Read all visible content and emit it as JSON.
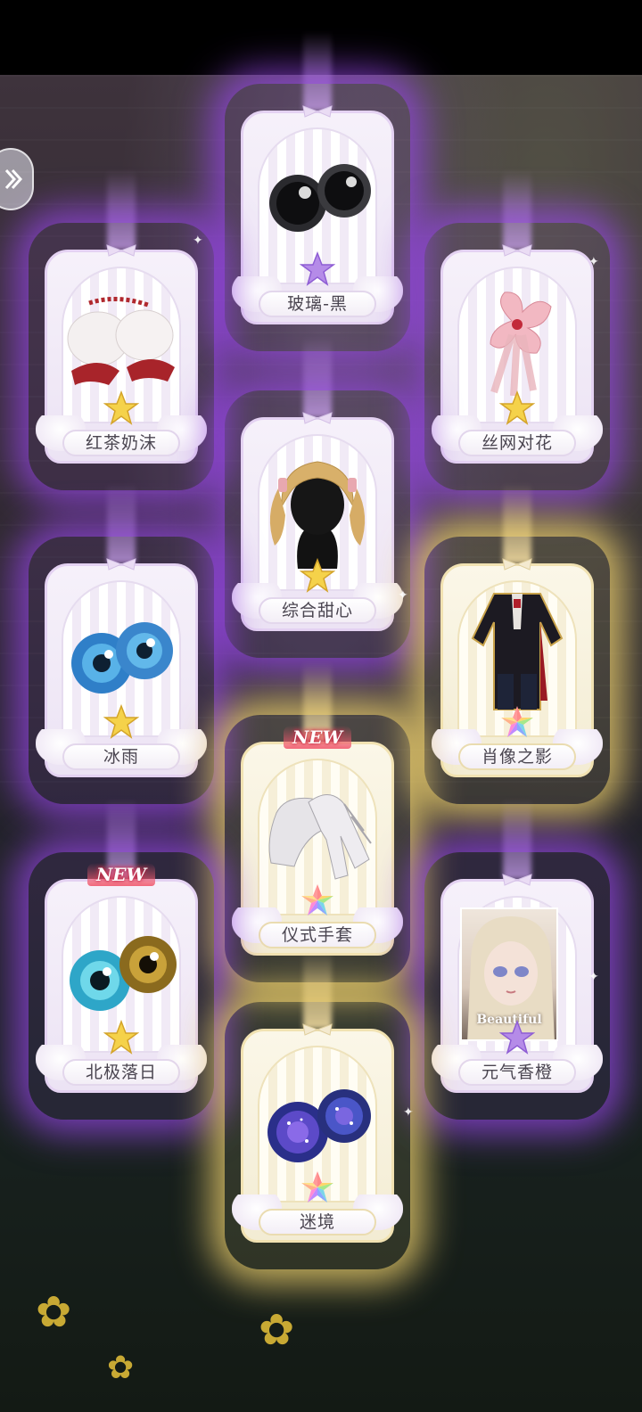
{
  "new_badge": "NEW",
  "cards": [
    {
      "id": "glass-black",
      "label": "玻璃-黑",
      "rarity": "purple",
      "item": "eyes-black",
      "new": false
    },
    {
      "id": "milk-tea",
      "label": "红茶奶沫",
      "rarity": "gold",
      "item": "sleeves",
      "new": false
    },
    {
      "id": "silk-flower",
      "label": "丝网对花",
      "rarity": "gold",
      "item": "hair-flower",
      "new": false
    },
    {
      "id": "sweetheart",
      "label": "综合甜心",
      "rarity": "gold",
      "item": "hair-wig",
      "new": false
    },
    {
      "id": "ice-rain",
      "label": "冰雨",
      "rarity": "gold",
      "item": "eyes-blue",
      "new": false
    },
    {
      "id": "portrait-shadow",
      "label": "肖像之影",
      "rarity": "rainbow",
      "item": "outfit",
      "new": false
    },
    {
      "id": "ritual-gloves",
      "label": "仪式手套",
      "rarity": "rainbow",
      "item": "gloves",
      "new": true
    },
    {
      "id": "arctic-sunset",
      "label": "北极落日",
      "rarity": "gold",
      "item": "eyes-cyan-gold",
      "new": true
    },
    {
      "id": "genki-orange",
      "label": "元气香橙",
      "rarity": "purple",
      "item": "portrait",
      "new": false,
      "caption": "Beautiful"
    },
    {
      "id": "maze",
      "label": "迷境",
      "rarity": "rainbow",
      "item": "eyes-galaxy",
      "new": false
    }
  ],
  "colors": {
    "purple_glow": "#9646e6",
    "gold_glow": "#f0d26e",
    "label_text": "#4a4550"
  }
}
